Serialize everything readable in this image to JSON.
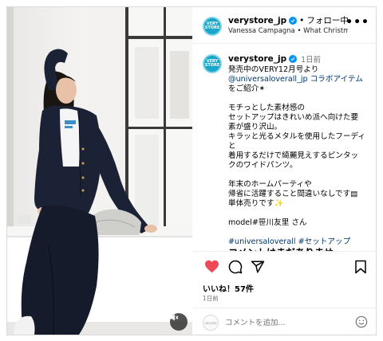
{
  "post": {
    "username": "verystore_jp",
    "avatar_text": "VERY STORE",
    "follow_label": "フォロー中",
    "subtitle": "Vanessa Campagna • What Christm...",
    "more_label": "•••"
  },
  "caption": {
    "username": "verystore_jp",
    "time": "1日前",
    "lines": [
      "発売中のVERY12月号より",
      "@universaloverall_jp コラボアイテム",
      "をご紹介✴︎",
      "",
      "モチっとした素材感の",
      "セットアップはきれいめ派へ向けた要",
      "素が盛り沢山。",
      "キラッと光るメタルを使用したフーディ",
      "と",
      "着用するだけで綺麗見えするピンタッ",
      "クのワイドパンツ。",
      "",
      "年末のホームパーティや",
      "帰省に活躍すること間違いなしです▤",
      "単体売りです✨",
      "",
      "model#笹川友里 さん",
      "",
      "#universaloverall #セットアップ"
    ],
    "cut_off_line": "コメントはまだありませ"
  },
  "actions": {
    "likes": "いいね！57件",
    "date": "1日前"
  },
  "comment": {
    "avatar_text": "verysto",
    "placeholder": "コメントを追加..."
  },
  "colors": {
    "heart": "#ed4956",
    "link": "#00376b",
    "verified": "#0095f6",
    "brand": "#1aa6c9"
  },
  "icons": [
    "heart-icon",
    "comment-icon",
    "share-icon",
    "bookmark-icon",
    "smile-emoji-icon",
    "mute-icon",
    "verified-badge-icon",
    "more-icon"
  ]
}
